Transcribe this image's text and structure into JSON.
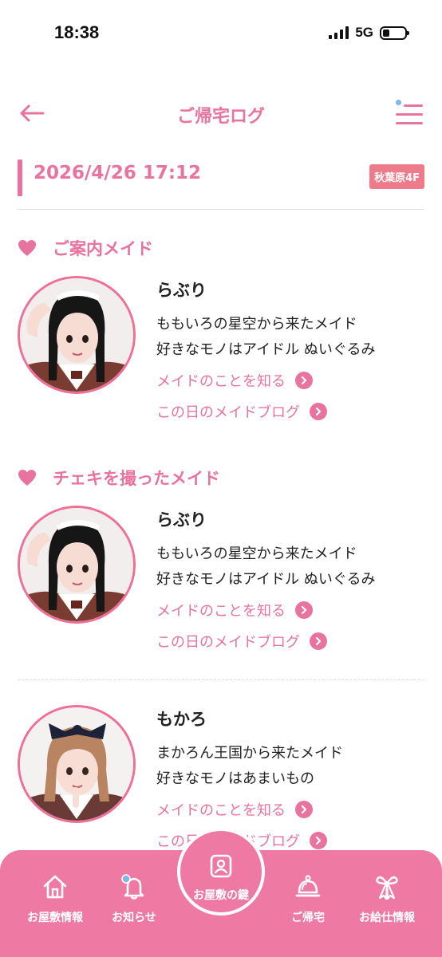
{
  "status_bar": {
    "time": "18:38",
    "network": "5G",
    "battery_level": 0.3
  },
  "header": {
    "title": "ご帰宅ログ",
    "back_icon": "arrow-left-icon",
    "menu_icon": "menu-icon"
  },
  "visit": {
    "datetime": "2026/4/26 17:12",
    "store": "秋葉原4F"
  },
  "sections": {
    "guide": {
      "title": "ご案内メイド"
    },
    "cheki": {
      "title": "チェキを撮ったメイド"
    }
  },
  "guide_maid": {
    "name": "らぶり",
    "origin": "ももいろの星空から来たメイド",
    "likes": "好きなモノはアイドル ぬいぐるみ",
    "about_link": "メイドのことを知る",
    "blog_link": "この日のメイドブログ"
  },
  "cheki_maids": [
    {
      "name": "らぶり",
      "origin": "ももいろの星空から来たメイド",
      "likes": "好きなモノはアイドル ぬいぐるみ",
      "about_link": "メイドのことを知る",
      "blog_link": "この日のメイドブログ"
    },
    {
      "name": "もかろ",
      "origin": "まかろん王国から来たメイド",
      "likes": "好きなモノはあまいもの",
      "about_link": "メイドのことを知る",
      "blog_link": "この日のメイドブログ"
    }
  ],
  "bottom_nav": {
    "home": {
      "label": "お屋敷情報",
      "icon": "house-icon"
    },
    "news": {
      "label": "お知らせ",
      "icon": "bell-icon"
    },
    "key": {
      "label": "お屋敷の鍵",
      "icon": "member-card-icon"
    },
    "return": {
      "label": "ご帰宅",
      "icon": "service-bell-icon"
    },
    "info": {
      "label": "お給仕情報",
      "icon": "ribbon-icon"
    }
  },
  "colors": {
    "accent": "#e8739f",
    "nav_bg": "#ee79a2",
    "badge": "#ee7b8c"
  }
}
